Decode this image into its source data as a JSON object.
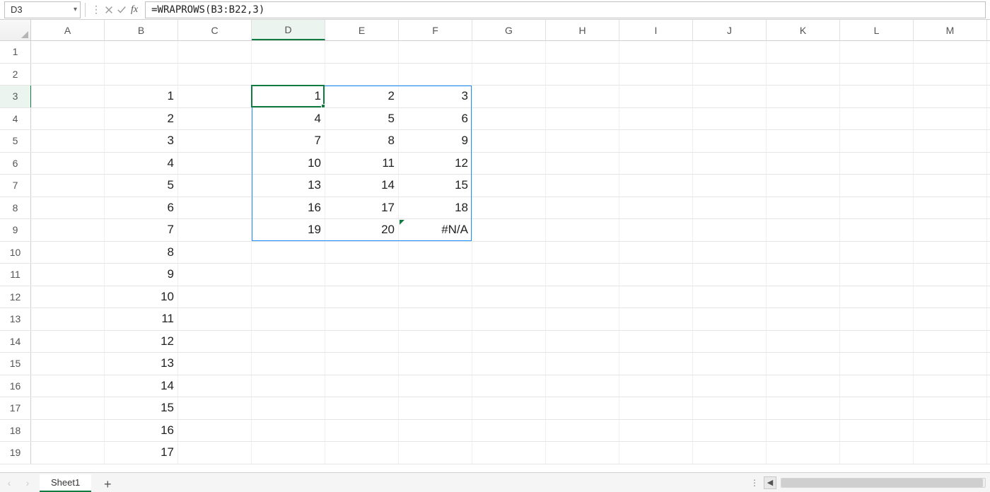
{
  "formula_bar": {
    "cell_ref": "D3",
    "formula": "=WRAPROWS(B3:B22,3)"
  },
  "columns": [
    "A",
    "B",
    "C",
    "D",
    "E",
    "F",
    "G",
    "H",
    "I",
    "J",
    "K",
    "L",
    "M"
  ],
  "selected_column": "D",
  "rows_visible": 19,
  "selected_row": 3,
  "cells": {
    "B3": "1",
    "B4": "2",
    "B5": "3",
    "B6": "4",
    "B7": "5",
    "B8": "6",
    "B9": "7",
    "B10": "8",
    "B11": "9",
    "B12": "10",
    "B13": "11",
    "B14": "12",
    "B15": "13",
    "B16": "14",
    "B17": "15",
    "B18": "16",
    "B19": "17",
    "D3": "1",
    "E3": "2",
    "F3": "3",
    "D4": "4",
    "E4": "5",
    "F4": "6",
    "D5": "7",
    "E5": "8",
    "F5": "9",
    "D6": "10",
    "E6": "11",
    "F6": "12",
    "D7": "13",
    "E7": "14",
    "F7": "15",
    "D8": "16",
    "E8": "17",
    "F8": "18",
    "D9": "19",
    "E9": "20",
    "F9": "#N/A"
  },
  "error_flag_cell": "F9",
  "spill_range": {
    "top_row": 3,
    "left_col": "D",
    "bottom_row": 9,
    "right_col": "F"
  },
  "active_cell": "D3",
  "sheet_tabs": {
    "active": "Sheet1",
    "tabs": [
      "Sheet1"
    ]
  }
}
